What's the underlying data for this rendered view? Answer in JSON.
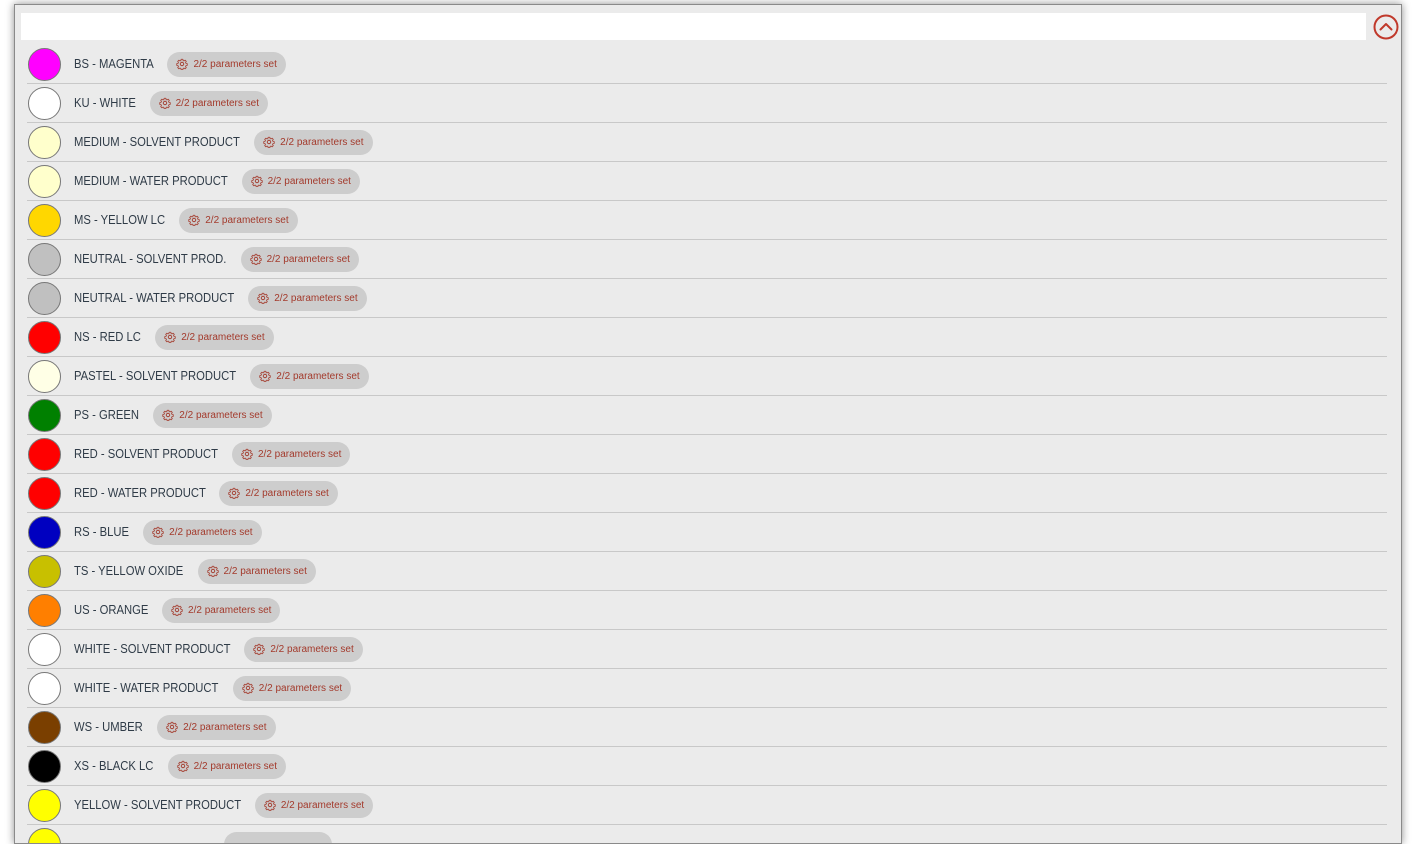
{
  "search": {
    "value": "",
    "placeholder": ""
  },
  "collapse_icon": "chevron-up-circle-icon",
  "accent_color": "#c0392b",
  "items": [
    {
      "label": "BS - MAGENTA",
      "color": "#ff00ff",
      "params": "2/2 parameters set"
    },
    {
      "label": "KU - WHITE",
      "color": "#ffffff",
      "params": "2/2 parameters set"
    },
    {
      "label": "MEDIUM - SOLVENT PRODUCT",
      "color": "#ffffcc",
      "params": "2/2 parameters set"
    },
    {
      "label": "MEDIUM - WATER PRODUCT",
      "color": "#ffffcc",
      "params": "2/2 parameters set"
    },
    {
      "label": "MS - YELLOW LC",
      "color": "#ffd700",
      "params": "2/2 parameters set"
    },
    {
      "label": "NEUTRAL - SOLVENT PROD.",
      "color": "#c0c0c0",
      "params": "2/2 parameters set"
    },
    {
      "label": "NEUTRAL - WATER PRODUCT",
      "color": "#c0c0c0",
      "params": "2/2 parameters set"
    },
    {
      "label": "NS - RED LC",
      "color": "#ff0000",
      "params": "2/2 parameters set"
    },
    {
      "label": "PASTEL - SOLVENT PRODUCT",
      "color": "#ffffe6",
      "params": "2/2 parameters set"
    },
    {
      "label": "PS - GREEN",
      "color": "#008000",
      "params": "2/2 parameters set"
    },
    {
      "label": "RED - SOLVENT PRODUCT",
      "color": "#ff0000",
      "params": "2/2 parameters set"
    },
    {
      "label": "RED - WATER PRODUCT",
      "color": "#ff0000",
      "params": "2/2 parameters set"
    },
    {
      "label": "RS - BLUE",
      "color": "#0000c0",
      "params": "2/2 parameters set"
    },
    {
      "label": "TS - YELLOW OXIDE",
      "color": "#c8c000",
      "params": "2/2 parameters set"
    },
    {
      "label": "US - ORANGE",
      "color": "#ff7f00",
      "params": "2/2 parameters set"
    },
    {
      "label": "WHITE - SOLVENT PRODUCT",
      "color": "#ffffff",
      "params": "2/2 parameters set"
    },
    {
      "label": "WHITE - WATER PRODUCT",
      "color": "#ffffff",
      "params": "2/2 parameters set"
    },
    {
      "label": "WS - UMBER",
      "color": "#7a3f00",
      "params": "2/2 parameters set"
    },
    {
      "label": "XS - BLACK LC",
      "color": "#000000",
      "params": "2/2 parameters set"
    },
    {
      "label": "YELLOW - SOLVENT PRODUCT",
      "color": "#ffff00",
      "params": "2/2 parameters set"
    },
    {
      "label": "",
      "color": "#ffff00",
      "params": ""
    }
  ]
}
